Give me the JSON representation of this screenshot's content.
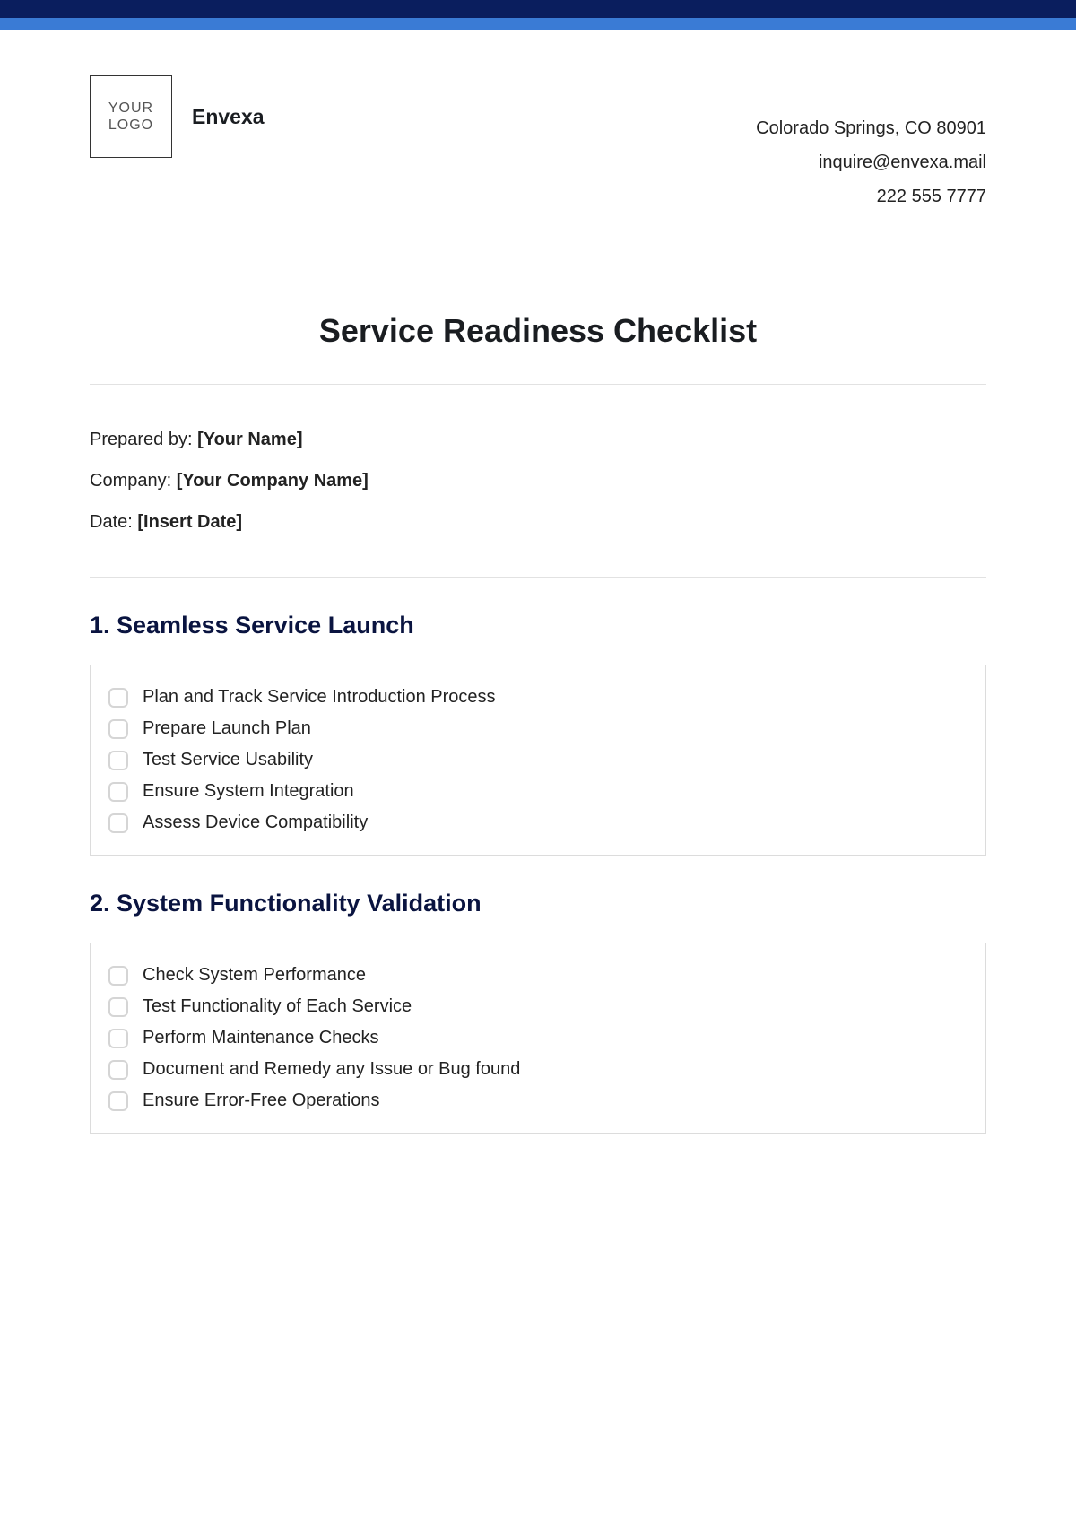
{
  "header": {
    "logo_line1": "YOUR",
    "logo_line2": "LOGO",
    "company": "Envexa",
    "address": "Colorado Springs, CO 80901",
    "email": "inquire@envexa.mail",
    "phone": "222 555 7777"
  },
  "title": "Service Readiness Checklist",
  "meta": {
    "prepared_by_label": "Prepared by: ",
    "prepared_by_value": "[Your Name]",
    "company_label": "Company: ",
    "company_value": "[Your Company Name]",
    "date_label": "Date: ",
    "date_value": "[Insert Date]"
  },
  "sections": [
    {
      "title": "1. Seamless Service Launch",
      "items": [
        "Plan and Track Service Introduction Process",
        "Prepare Launch Plan",
        "Test Service Usability",
        "Ensure System Integration",
        "Assess Device Compatibility"
      ]
    },
    {
      "title": "2. System Functionality Validation",
      "items": [
        "Check System Performance",
        "Test Functionality of Each Service",
        "Perform Maintenance Checks",
        "Document and Remedy any Issue or Bug found",
        "Ensure Error-Free Operations"
      ]
    }
  ]
}
